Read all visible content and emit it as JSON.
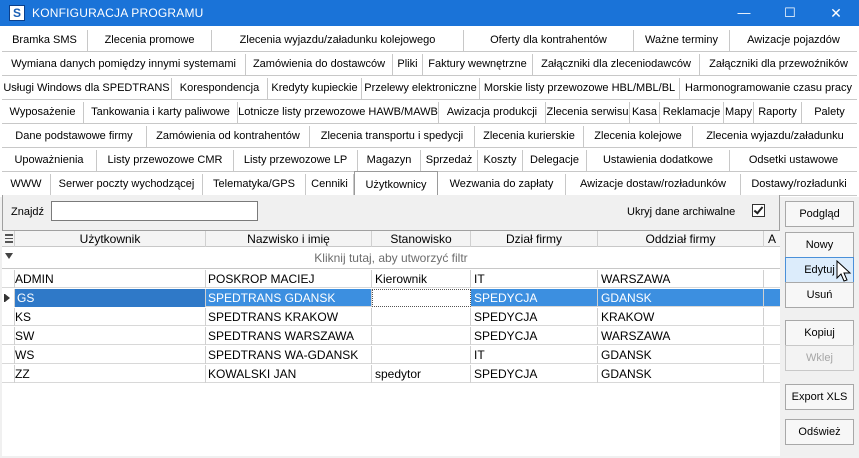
{
  "window": {
    "title": "KONFIGURACJA PROGRAMU",
    "icon_letter": "S",
    "min_glyph": "—",
    "max_glyph": "☐",
    "close_glyph": "✕"
  },
  "tab_rows": [
    [
      "Bramka SMS",
      "Zlecenia promowe",
      "Zlecenia wyjazdu/załadunku kolejowego",
      "Oferty dla kontrahentów",
      "Ważne terminy",
      "Awizacje pojazdów"
    ],
    [
      "Wymiana danych pomiędzy innymi systemami",
      "Zamówienia do dostawców",
      "Pliki",
      "Faktury wewnętrzne",
      "Załączniki dla zleceniodawców",
      "Załączniki dla przewoźników"
    ],
    [
      "Usługi Windows dla SPEDTRANS",
      "Korespondencja",
      "Kredyty kupieckie",
      "Przelewy elektroniczne",
      "Morskie listy przewozowe HBL/MBL/BL",
      "Harmonogramowanie czasu pracy"
    ],
    [
      "Wyposażenie",
      "Tankowania i karty paliwowe",
      "Lotnicze listy przewozowe HAWB/MAWB",
      "Awizacja produkcji",
      "Zlecenia serwisu",
      "Kasa",
      "Reklamacje",
      "Mapy",
      "Raporty",
      "Palety"
    ],
    [
      "Dane podstawowe firmy",
      "Zamówienia od kontrahentów",
      "Zlecenia transportu i spedycji",
      "Zlecenia kurierskie",
      "Zlecenia kolejowe",
      "Zlecenia wyjazdu/załadunku"
    ],
    [
      "Upoważnienia",
      "Listy przewozowe CMR",
      "Listy przewozowe LP",
      "Magazyn",
      "Sprzedaż",
      "Koszty",
      "Delegacje",
      "Ustawienia dodatkowe",
      "Odsetki ustawowe"
    ],
    [
      "WWW",
      "Serwer poczty wychodzącej",
      "Telematyka/GPS",
      "Cenniki",
      "Użytkownicy",
      "Wezwania do zapłaty",
      "Awizacje dostaw/rozładunków",
      "Dostawy/rozładunki"
    ]
  ],
  "active_tab": "Użytkownicy",
  "search": {
    "label": "Znajdź",
    "value": "",
    "placeholder": ""
  },
  "archive": {
    "label": "Ukryj dane archiwalne",
    "checked": true
  },
  "grid": {
    "columns": [
      "Użytkownik",
      "Nazwisko i imię",
      "Stanowisko",
      "Dział firmy",
      "Oddział firmy",
      "A"
    ],
    "filter_hint": "Kliknij tutaj, aby utworzyć filtr",
    "rows": [
      [
        "ADMIN",
        "POSKROP MACIEJ",
        "Kierownik",
        "IT",
        "WARSZAWA"
      ],
      [
        "GS",
        "SPEDTRANS GDANSK",
        "",
        "SPEDYCJA",
        "GDANSK"
      ],
      [
        "KS",
        "SPEDTRANS KRAKOW",
        "",
        "SPEDYCJA",
        "KRAKOW"
      ],
      [
        "SW",
        "SPEDTRANS WARSZAWA",
        "",
        "SPEDYCJA",
        "WARSZAWA"
      ],
      [
        "WS",
        "SPEDTRANS WA-GDANSK",
        "",
        "IT",
        "GDANSK"
      ],
      [
        "ZZ",
        "KOWALSKI JAN",
        "spedytor",
        "SPEDYCJA",
        "GDANSK"
      ]
    ],
    "selected_row": 1
  },
  "buttons": {
    "preview": "Podgląd",
    "new": "Nowy",
    "edit": "Edytuj",
    "delete": "Usuń",
    "copy": "Kopiuj",
    "paste": "Wklej",
    "export": "Export XLS",
    "refresh": "Odśwież"
  },
  "colors": {
    "title_bar": "#1a73d8",
    "selection": "#3c8fe0"
  }
}
